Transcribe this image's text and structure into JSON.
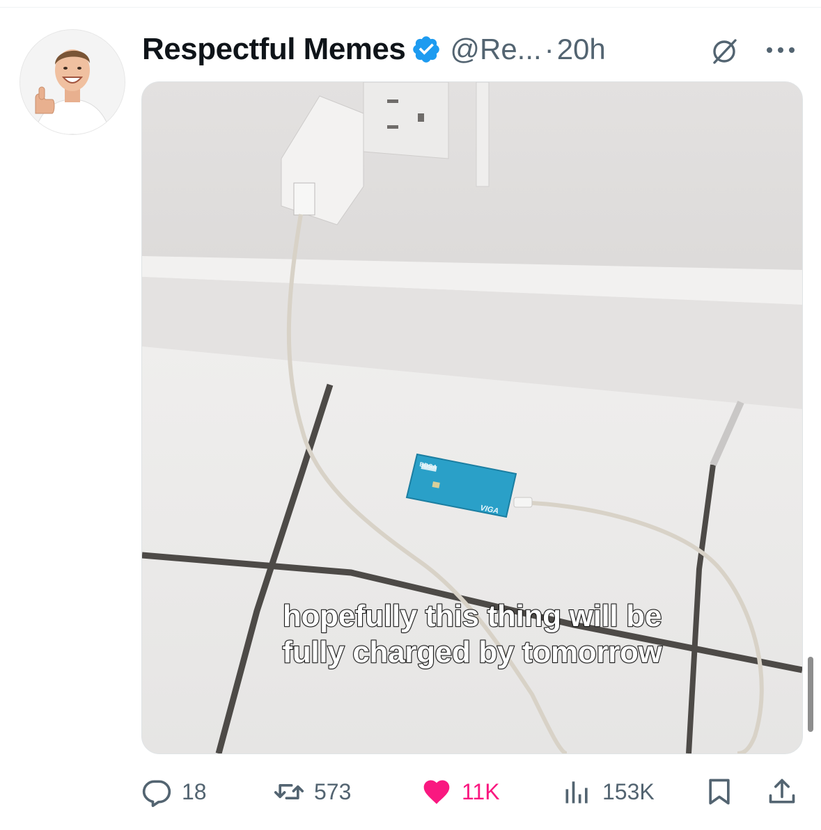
{
  "post": {
    "display_name": "Respectful Memes",
    "handle": "@Re...",
    "separator": "·",
    "time": "20h",
    "verified": true,
    "avatar_icon": "avatar-thumbs-up-photo",
    "media": {
      "caption_line1": "hopefully this thing will be",
      "caption_line2": "fully charged by tomorrow",
      "card_brand_top": "BDSA",
      "card_brand_bottom": "VIGA"
    },
    "actions": {
      "replies": "18",
      "reposts": "573",
      "likes": "11K",
      "views": "153K",
      "liked": true
    }
  },
  "colors": {
    "accent_blue": "#1d9bf0",
    "like_pink": "#f91880",
    "secondary_text": "#536471",
    "primary_text": "#0f1419"
  },
  "icons": [
    "verified-badge-icon",
    "grok-icon",
    "more-icon",
    "reply-icon",
    "repost-icon",
    "like-icon",
    "views-icon",
    "bookmark-icon",
    "share-icon"
  ]
}
